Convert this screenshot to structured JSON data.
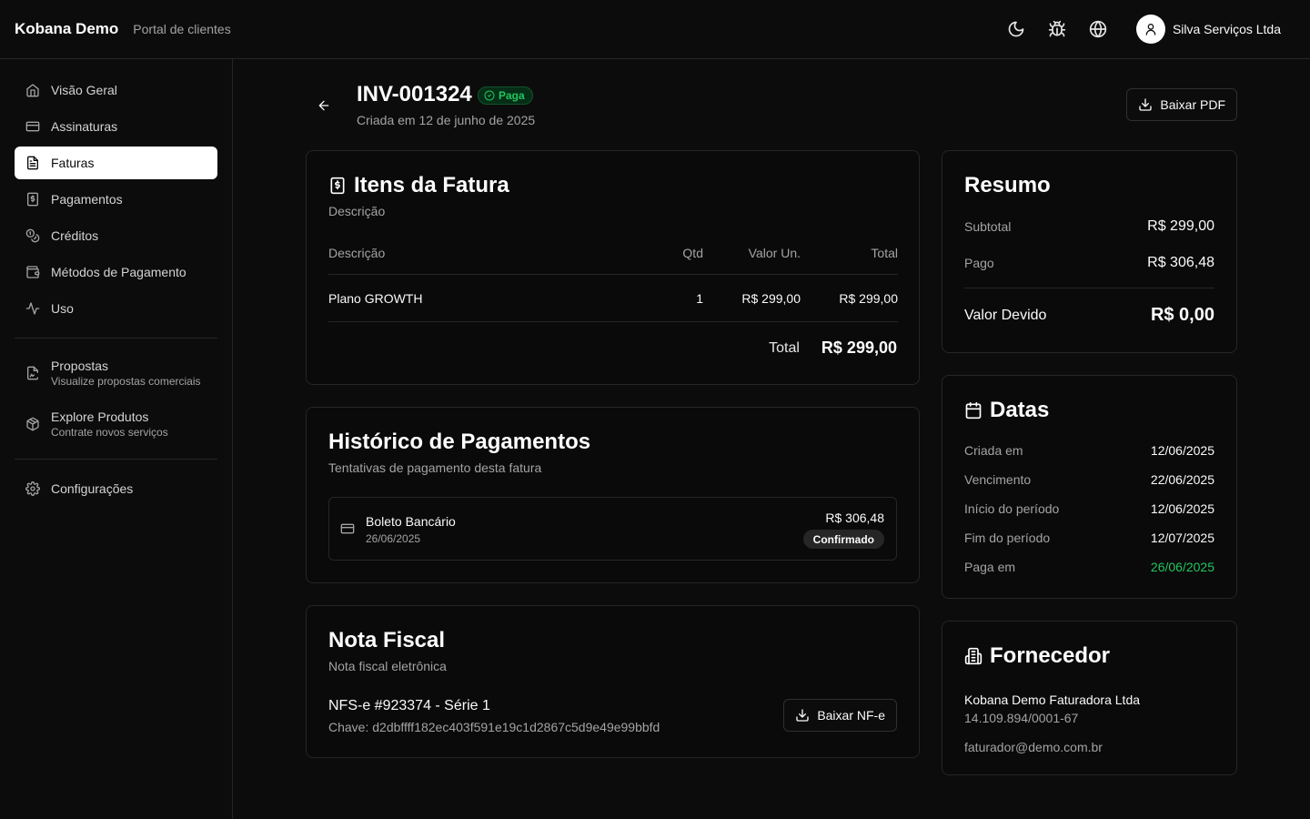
{
  "header": {
    "brand": "Kobana Demo",
    "portal": "Portal de clientes",
    "user_name": "Silva Serviços Ltda",
    "icons": [
      "moon-icon",
      "bug-icon",
      "globe-icon",
      "user-icon"
    ]
  },
  "sidebar": {
    "items": [
      {
        "label": "Visão Geral",
        "icon": "home-icon"
      },
      {
        "label": "Assinaturas",
        "icon": "card-icon"
      },
      {
        "label": "Faturas",
        "icon": "file-icon",
        "active": true
      },
      {
        "label": "Pagamentos",
        "icon": "receipt-icon"
      },
      {
        "label": "Créditos",
        "icon": "coins-icon"
      },
      {
        "label": "Métodos de Pagamento",
        "icon": "wallet-icon"
      },
      {
        "label": "Uso",
        "icon": "activity-icon"
      }
    ],
    "secondary": [
      {
        "label": "Propostas",
        "sub": "Visualize propostas comerciais",
        "icon": "file-signature-icon"
      },
      {
        "label": "Explore Produtos",
        "sub": "Contrate novos serviços",
        "icon": "package-icon"
      }
    ],
    "settings": {
      "label": "Configurações",
      "icon": "gear-icon"
    }
  },
  "invoice": {
    "id": "INV-001324",
    "status": "Paga",
    "created": "Criada em 12 de junho de 2025",
    "download_pdf": "Baixar PDF"
  },
  "items_card": {
    "title": "Itens da Fatura",
    "subtitle": "Descrição",
    "columns": {
      "desc": "Descrição",
      "qty": "Qtd",
      "unit": "Valor Un.",
      "total": "Total"
    },
    "rows": [
      {
        "desc": "Plano GROWTH",
        "qty": "1",
        "unit": "R$ 299,00",
        "total": "R$ 299,00"
      }
    ],
    "total_label": "Total",
    "total_value": "R$ 299,00"
  },
  "history_card": {
    "title": "Histórico de Pagamentos",
    "subtitle": "Tentativas de pagamento desta fatura",
    "payments": [
      {
        "method": "Boleto Bancário",
        "date": "26/06/2025",
        "amount": "R$ 306,48",
        "status": "Confirmado"
      }
    ]
  },
  "nota_card": {
    "title": "Nota Fiscal",
    "subtitle": "Nota fiscal eletrônica",
    "number": "NFS-e #923374 - Série 1",
    "key": "Chave: d2dbffff182ec403f591e19c1d2867c5d9e49e99bbfd",
    "download": "Baixar NF-e"
  },
  "resumo_card": {
    "title": "Resumo",
    "subtotal_label": "Subtotal",
    "subtotal": "R$ 299,00",
    "paid_label": "Pago",
    "paid": "R$ 306,48",
    "due_label": "Valor Devido",
    "due": "R$ 0,00"
  },
  "datas_card": {
    "title": "Datas",
    "rows": [
      {
        "label": "Criada em",
        "value": "12/06/2025"
      },
      {
        "label": "Vencimento",
        "value": "22/06/2025"
      },
      {
        "label": "Início do período",
        "value": "12/06/2025"
      },
      {
        "label": "Fim do período",
        "value": "12/07/2025"
      },
      {
        "label": "Paga em",
        "value": "26/06/2025"
      }
    ],
    "paid_color": "#22c55e"
  },
  "fornecedor_card": {
    "title": "Fornecedor",
    "name": "Kobana Demo Faturadora Ltda",
    "cnpj": "14.109.894/0001-67",
    "email": "faturador@demo.com.br"
  }
}
